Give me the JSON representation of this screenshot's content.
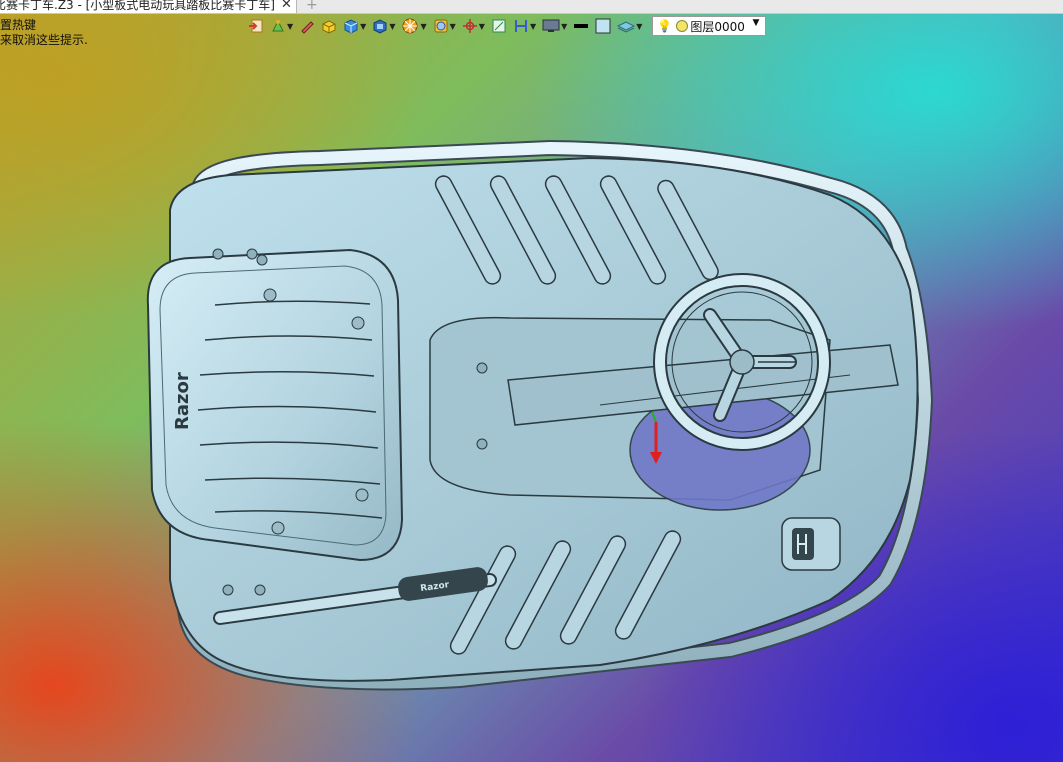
{
  "tab": {
    "title": "比赛卡丁车.Z3 - [小型板式电动玩具踏板比赛卡丁车]",
    "close_glyph": "✕",
    "add_glyph": "+"
  },
  "hints": {
    "line1": "置热键",
    "line2": "来取消这些提示."
  },
  "toolbar": {
    "icons": [
      "exit-icon",
      "paint-icon",
      "pencil-icon",
      "box-icon",
      "cube-icon",
      "view-cube-icon",
      "render-icon",
      "display-icon",
      "axis-icon",
      "frame-icon",
      "section-icon",
      "monitor-icon",
      "line-color-icon",
      "fill-color-icon",
      "layer-stack-icon"
    ],
    "layer_label": "图层0000"
  },
  "model": {
    "brand_text": "Razor",
    "handle_text": "Razor"
  }
}
